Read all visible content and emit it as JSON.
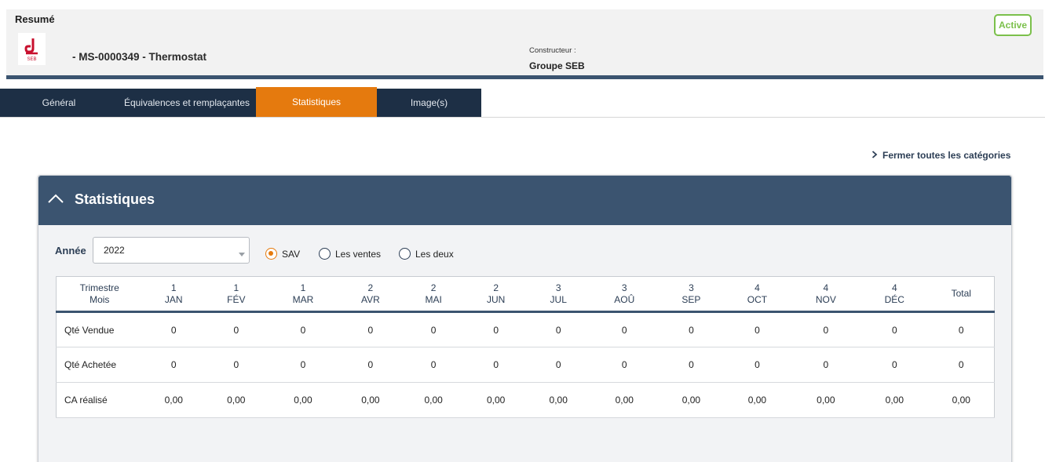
{
  "header": {
    "title": "Resumé",
    "product_title": "- MS-0000349 - Thermostat",
    "constructeur_label": "Constructeur :",
    "constructeur_value": "Groupe SEB",
    "status": "Active",
    "logo_text": "SEB"
  },
  "tabs": [
    {
      "label": "Général"
    },
    {
      "label": "Équivalences et remplaçantes"
    },
    {
      "label": "Statistiques",
      "active": true
    },
    {
      "label": "Image(s)"
    }
  ],
  "close_all": {
    "label": "Fermer toutes les catégories"
  },
  "panel": {
    "title": "Statistiques",
    "year_label": "Année",
    "year_value": "2022",
    "radios": [
      {
        "label": "SAV",
        "selected": true
      },
      {
        "label": "Les ventes",
        "selected": false
      },
      {
        "label": "Les deux",
        "selected": false
      }
    ]
  },
  "table": {
    "header_first_line1": "Trimestre",
    "header_first_line2": "Mois",
    "columns": [
      {
        "q": "1",
        "m": "JAN"
      },
      {
        "q": "1",
        "m": "FÉV"
      },
      {
        "q": "1",
        "m": "MAR"
      },
      {
        "q": "2",
        "m": "AVR"
      },
      {
        "q": "2",
        "m": "MAI"
      },
      {
        "q": "2",
        "m": "JUN"
      },
      {
        "q": "3",
        "m": "JUL"
      },
      {
        "q": "3",
        "m": "AOÛ"
      },
      {
        "q": "3",
        "m": "SEP"
      },
      {
        "q": "4",
        "m": "OCT"
      },
      {
        "q": "4",
        "m": "NOV"
      },
      {
        "q": "4",
        "m": "DÉC"
      }
    ],
    "total_label": "Total",
    "rows": [
      {
        "label": "Qté Vendue",
        "values": [
          "0",
          "0",
          "0",
          "0",
          "0",
          "0",
          "0",
          "0",
          "0",
          "0",
          "0",
          "0"
        ],
        "total": "0"
      },
      {
        "label": "Qté Achetée",
        "values": [
          "0",
          "0",
          "0",
          "0",
          "0",
          "0",
          "0",
          "0",
          "0",
          "0",
          "0",
          "0"
        ],
        "total": "0"
      },
      {
        "label": "CA réalisé",
        "values": [
          "0,00",
          "0,00",
          "0,00",
          "0,00",
          "0,00",
          "0,00",
          "0,00",
          "0,00",
          "0,00",
          "0,00",
          "0,00",
          "0,00"
        ],
        "total": "0,00"
      }
    ]
  },
  "colors": {
    "accent": "#e57a0e",
    "navy": "#1d2f45",
    "panel_header": "#3b5470",
    "active_green": "#7bc04b"
  }
}
